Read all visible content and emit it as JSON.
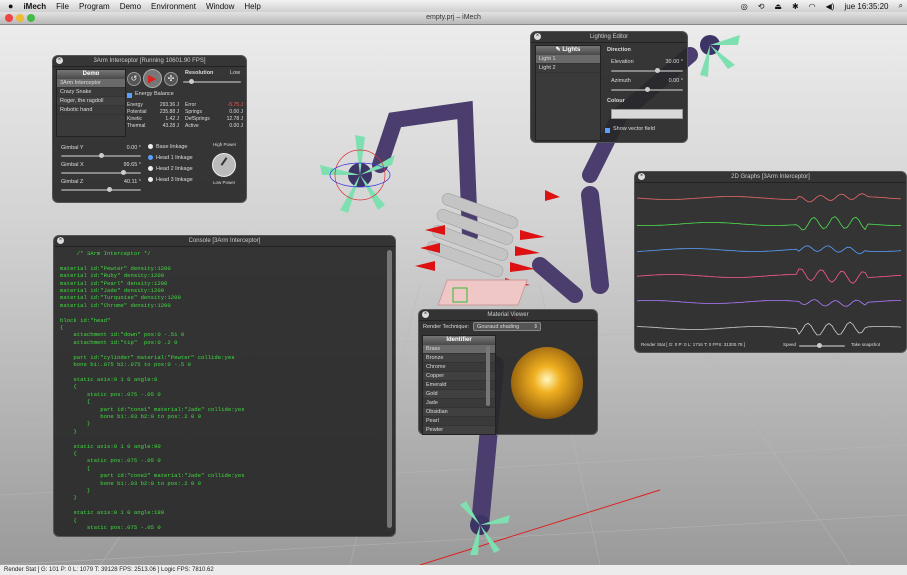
{
  "menubar": {
    "app": "iMech",
    "items": [
      "File",
      "Program",
      "Demo",
      "Environment",
      "Window",
      "Help"
    ],
    "clock": "jue 16:35:20"
  },
  "window": {
    "title": "empty.prj – iMech"
  },
  "interceptor": {
    "title": "3Arm Interceptor [Running 10601.90 FPS]",
    "demo_header": "Demo",
    "demos": [
      "3Arm Interceptor",
      "Crazy Snake",
      "Roger, the ragdoll",
      "Robotic hand"
    ],
    "resolution_label": "Resolution",
    "resolution_low": "Low",
    "energy_balance_label": "Energy Balance",
    "stats": [
      [
        "Energy",
        "293.36 J",
        "Error",
        "-5.75 J"
      ],
      [
        "Potential",
        "235.88 J",
        "Springs",
        "0.00 J"
      ],
      [
        "Kinetic",
        "1.42 J",
        "DefSprings",
        "12.78 J"
      ],
      [
        "Thermal",
        "43.28 J",
        "Active",
        "0.00 J"
      ]
    ],
    "gimbals": [
      {
        "label": "Gimbal Y",
        "value": "0.00 °",
        "fraction": 0.5
      },
      {
        "label": "Gimbal X",
        "value": "99.65 °",
        "fraction": 0.78
      },
      {
        "label": "Gimbal Z",
        "value": "40.11 °",
        "fraction": 0.6
      }
    ],
    "linkages": [
      "Base linkage",
      "Head 1 linkage",
      "Head 2 linkage",
      "Head 3 linkage"
    ],
    "selected_linkage": 1,
    "power_high": "High Power",
    "power_low": "Low Power"
  },
  "lighting": {
    "title": "Lighting Editor",
    "lights_header": "Lights",
    "lights": [
      "Light 1",
      "Light 2"
    ],
    "direction_label": "Direction",
    "elevation_label": "Elevation",
    "elevation_value": "30.00 °",
    "azimuth_label": "Azimuth",
    "azimuth_value": "0.00 °",
    "colour_label": "Colour",
    "show_vector_label": "Show vector field"
  },
  "console": {
    "title": "Console [3Arm Interceptor]",
    "lines": [
      "     /* 3Arm Interceptor */",
      "",
      "material id:\"Pewter\" density:1200",
      "material id:\"Ruby\" density:1200",
      "material id:\"Pearl\" density:1200",
      "material id:\"Jade\" density:1200",
      "material id:\"Turquoise\" density:1200",
      "material id:\"Chrome\" density:1200",
      "",
      "block id:\"head\"",
      "{",
      "    attachment id:\"down\" pos:0 -.51 0",
      "    attachment id:\"tip\"  pos:0 .2 0",
      "",
      "    part id:\"cylinder\" material:\"Pewter\" collide:yes",
      "    bone b1:.075 b2:.075 to pos:0 -.5 0",
      "",
      "    static axis:0 1 0 angle:0",
      "    {",
      "        static pos:.075 -.05 0",
      "        {",
      "            part id:\"cone1\" material:\"Jade\" collide:yes",
      "            bone b1:.03 b2:0 to pos:.2 0 0",
      "        }",
      "    }",
      "",
      "    static axis:0 1 0 angle:90",
      "    {",
      "        static pos:.075 -.05 0",
      "        {",
      "            part id:\"cone2\" material:\"Jade\" collide:yes",
      "            bone b1:.03 b2:0 to pos:.2 0 0",
      "        }",
      "    }",
      "",
      "    static axis:0 1 0 angle:180",
      "    {",
      "        static pos:.075 -.05 0"
    ]
  },
  "material_viewer": {
    "title": "Material Viewer",
    "technique_label": "Render Technique:",
    "technique_value": "Gouraud shading",
    "identifier_header": "Identifier",
    "materials": [
      "Brass",
      "Bronze",
      "Chrome",
      "Copper",
      "Emerald",
      "Gold",
      "Jade",
      "Obsidian",
      "Pearl",
      "Pewter"
    ],
    "selected": 0
  },
  "graphs": {
    "title": "2D Graphs [3Arm Interceptor]",
    "status": "Render Stat [ G: 0  P: 0  L: 1716  T: 0  FPS: 31300.78 ]",
    "speed_label": "Speed",
    "snapshot_label": "Take snapshot",
    "colors": [
      "#e86a6a",
      "#4fe24f",
      "#5aa0ff",
      "#ff5a8a",
      "#b07aff",
      "#d0d0d0"
    ]
  },
  "statusbar": {
    "text": "Render Stat [ G: 101  P: 0  L: 1079  T: 39128  FPS: 2513.06 ]  Logic FPS: 7810.62"
  }
}
